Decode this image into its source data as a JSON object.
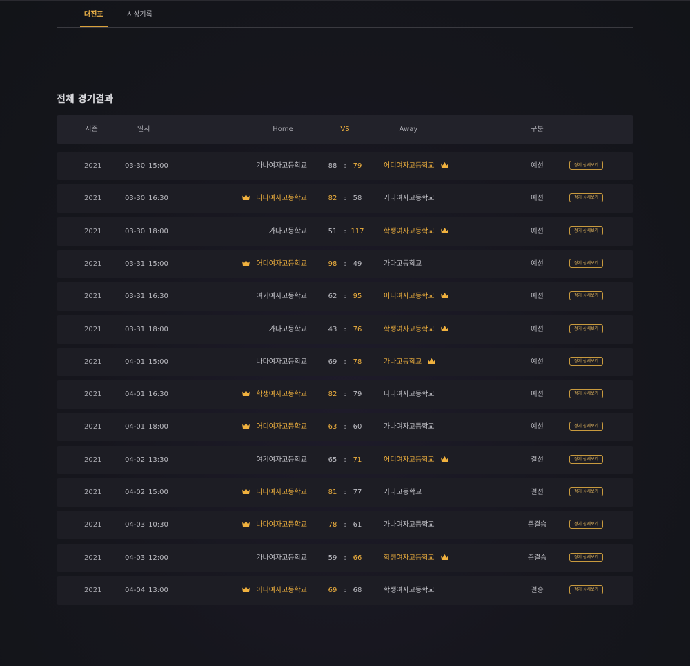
{
  "tabs": [
    {
      "label": "대진표",
      "active": true
    },
    {
      "label": "시상기록",
      "active": false
    }
  ],
  "section_title": "전체 경기결과",
  "headers": {
    "season": "시즌",
    "date": "일시",
    "home": "Home",
    "vs": "VS",
    "away": "Away",
    "type": "구분"
  },
  "detail_label": "경기 상세보기",
  "colors": {
    "accent": "#f0b13e",
    "row_bg": "#1d1d24",
    "header_bg": "#22222a",
    "bg": "#16161d"
  },
  "icons": {
    "winner": "crown-icon"
  },
  "matches": [
    {
      "season": "2021",
      "date": "03-30",
      "time": "15:00",
      "home": "가나여자고등학교",
      "home_score": "88",
      "away_score": "79",
      "away": "어디여자고등학교",
      "winner": "away",
      "type": "예선"
    },
    {
      "season": "2021",
      "date": "03-30",
      "time": "16:30",
      "home": "나다여자고등학교",
      "home_score": "82",
      "away_score": "58",
      "away": "가나여자고등학교",
      "winner": "home",
      "type": "예선"
    },
    {
      "season": "2021",
      "date": "03-30",
      "time": "18:00",
      "home": "가다고등학교",
      "home_score": "51",
      "away_score": "117",
      "away": "학생여자고등학교",
      "winner": "away",
      "type": "예선"
    },
    {
      "season": "2021",
      "date": "03-31",
      "time": "15:00",
      "home": "어디여자고등학교",
      "home_score": "98",
      "away_score": "49",
      "away": "가다고등학교",
      "winner": "home",
      "type": "예선"
    },
    {
      "season": "2021",
      "date": "03-31",
      "time": "16:30",
      "home": "여기여자고등학교",
      "home_score": "62",
      "away_score": "95",
      "away": "어디여자고등학교",
      "winner": "away",
      "type": "예선"
    },
    {
      "season": "2021",
      "date": "03-31",
      "time": "18:00",
      "home": "가나고등학교",
      "home_score": "43",
      "away_score": "76",
      "away": "학생여자고등학교",
      "winner": "away",
      "type": "예선"
    },
    {
      "season": "2021",
      "date": "04-01",
      "time": "15:00",
      "home": "나다여자고등학교",
      "home_score": "69",
      "away_score": "78",
      "away": "가나고등학교",
      "winner": "away",
      "type": "예선"
    },
    {
      "season": "2021",
      "date": "04-01",
      "time": "16:30",
      "home": "학생여자고등학교",
      "home_score": "82",
      "away_score": "79",
      "away": "나다여자고등학교",
      "winner": "home",
      "type": "예선"
    },
    {
      "season": "2021",
      "date": "04-01",
      "time": "18:00",
      "home": "어디여자고등학교",
      "home_score": "63",
      "away_score": "60",
      "away": "가나여자고등학교",
      "winner": "home",
      "type": "예선"
    },
    {
      "season": "2021",
      "date": "04-02",
      "time": "13:30",
      "home": "여기여자고등학교",
      "home_score": "65",
      "away_score": "71",
      "away": "어디여자고등학교",
      "winner": "away",
      "type": "결선"
    },
    {
      "season": "2021",
      "date": "04-02",
      "time": "15:00",
      "home": "나다여자고등학교",
      "home_score": "81",
      "away_score": "77",
      "away": "가나고등학교",
      "winner": "home",
      "type": "결선"
    },
    {
      "season": "2021",
      "date": "04-03",
      "time": "10:30",
      "home": "나다여자고등학교",
      "home_score": "78",
      "away_score": "61",
      "away": "가나여자고등학교",
      "winner": "home",
      "type": "준결승"
    },
    {
      "season": "2021",
      "date": "04-03",
      "time": "12:00",
      "home": "가나여자고등학교",
      "home_score": "59",
      "away_score": "66",
      "away": "학생여자고등학교",
      "winner": "away",
      "type": "준결승"
    },
    {
      "season": "2021",
      "date": "04-04",
      "time": "13:00",
      "home": "어디여자고등학교",
      "home_score": "69",
      "away_score": "68",
      "away": "학생여자고등학교",
      "winner": "home",
      "type": "결승"
    }
  ]
}
